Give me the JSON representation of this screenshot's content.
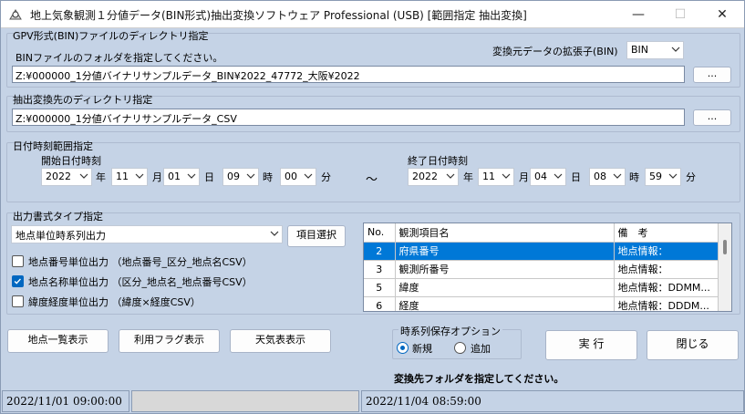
{
  "window": {
    "title": "地上気象観測１分値データ(BIN形式)抽出変換ソフトウェア Professional (USB) [範囲指定 抽出変換]",
    "minimize": "—",
    "maximize": "☐",
    "close": "✕"
  },
  "gpv": {
    "group_title": "GPV形式(BIN)ファイルのディレクトリ指定",
    "folder_label": "BINファイルのフォルダを指定してください。",
    "ext_label": "変換元データの拡張子(BIN)",
    "ext_value": "BIN",
    "path": "Z:¥000000_1分値バイナリサンプルデータ_BIN¥2022_47772_大阪¥2022",
    "browse": "..."
  },
  "dest": {
    "group_title": "抽出変換先のディレクトリ指定",
    "path": "Z:¥000000_1分値バイナリサンプルデータ_CSV",
    "browse": "..."
  },
  "range": {
    "group_title": "日付時刻範囲指定",
    "start_label": "開始日付時刻",
    "end_label": "終了日付時刻",
    "tilde": "～",
    "start": {
      "year": "2022",
      "month": "11",
      "day": "01",
      "hour": "09",
      "minute": "00"
    },
    "end": {
      "year": "2022",
      "month": "11",
      "day": "04",
      "hour": "08",
      "minute": "59"
    },
    "units": {
      "year": "年",
      "month": "月",
      "day": "日",
      "hour": "時",
      "minute": "分"
    }
  },
  "output": {
    "group_title": "出力書式タイプ指定",
    "format_value": "地点単位時系列出力",
    "item_select": "項目選択",
    "options": [
      {
        "label": "地点番号単位出力 （地点番号_区分_地点名CSV）",
        "checked": false
      },
      {
        "label": "地点名称単位出力 （区分_地点名_地点番号CSV）",
        "checked": true
      },
      {
        "label": "緯度経度単位出力 （緯度×経度CSV）",
        "checked": false
      }
    ]
  },
  "grid": {
    "headers": [
      "No.",
      "観測項目名",
      "備　考"
    ],
    "rows": [
      [
        "2",
        "府県番号",
        "地点情報："
      ],
      [
        "3",
        "観測所番号",
        "地点情報："
      ],
      [
        "5",
        "緯度",
        "地点情報：DDMM..."
      ],
      [
        "6",
        "経度",
        "地点情報：DDDM..."
      ]
    ],
    "selected_index": 0
  },
  "buttons": {
    "station_list": "地点一覧表示",
    "usage_flag": "利用フラグ表示",
    "weather_table": "天気表表示",
    "execute": "実 行",
    "close": "閉じる"
  },
  "save_option": {
    "group_title": "時系列保存オプション",
    "new_label": "新規",
    "append_label": "追加",
    "selected": "new"
  },
  "message": "変換先フォルダを指定してください。",
  "statusbar": {
    "start": "2022/11/01 09:00:00",
    "end": "2022/11/04 08:59:00"
  },
  "colors": {
    "background": "#c5d3e6",
    "selection": "#0078d7",
    "accent": "#0067c0"
  }
}
